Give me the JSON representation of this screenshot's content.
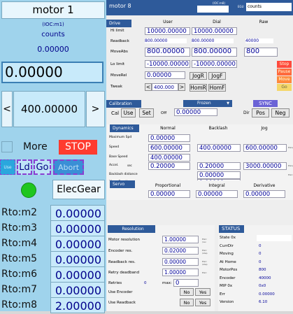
{
  "left": {
    "motor_title": "motor 1",
    "ioc": "(IOC:m1)",
    "units": "counts",
    "readback": "0.00000",
    "position": "0.00000",
    "tweak": "400.00000",
    "tweak_left": "<",
    "tweak_right": ">",
    "more": "More",
    "stop": "STOP",
    "set_label": "Use",
    "load": "Ld",
    "go": "Go",
    "abort": "Abort",
    "elecgear": "ElecGear",
    "ratios": [
      {
        "label": "Rto:m2",
        "value": "0.00000"
      },
      {
        "label": "Rto:m3",
        "value": "0.00000"
      },
      {
        "label": "Rto:m4",
        "value": "0.00000"
      },
      {
        "label": "Rto:m5",
        "value": "0.00000"
      },
      {
        "label": "Rto:m6",
        "value": "0.00000"
      },
      {
        "label": "Rto:m7",
        "value": "0.00000"
      },
      {
        "label": "Rto:m8",
        "value": "2.00000"
      }
    ]
  },
  "right": {
    "title": "motor 8",
    "ioc": "(IOC:m8)",
    "egu_label": "EGU",
    "egu": "counts",
    "drive": {
      "section": "Drive",
      "col_user": "User",
      "col_dial": "Dial",
      "col_raw": "Raw",
      "hilimit_label": "Hi limit",
      "hilimit_user": "10000.00000",
      "hilimit_dial": "10000.00000",
      "readback_label": "Readback",
      "readback_user": "800.00000",
      "readback_dial": "800.00000",
      "readback_raw": "40000",
      "moveabs_label": "MoveAbs",
      "moveabs_user": "800.00000",
      "moveabs_dial": "800.00000",
      "moveabs_raw": "800",
      "lolimit_label": "Lo limit",
      "lolimit_user": "-10000.00000",
      "lolimit_dial": "-10000.00000",
      "moverel_label": "MoveRel",
      "moverel_value": "0.00000",
      "jogr": "JogR",
      "jogf": "JogF",
      "tweak_label": "Tweak",
      "tweak_left": "<",
      "tweak_value": "400.000",
      "tweak_right": ">",
      "homr": "HomR",
      "homf": "HomF",
      "stop": "Stop",
      "pause": "Pause",
      "move": "Move",
      "go": "Go"
    },
    "calibration": {
      "section": "Calibration",
      "frozen": "Frozen",
      "sync": "SYNC",
      "cal": "Cal",
      "use": "Use",
      "set": "Set",
      "off": "Off",
      "off_value": "0.00000",
      "dir": "Dir",
      "pos": "Pos",
      "neg": "Neg"
    },
    "dynamics": {
      "section": "Dynamics",
      "col_normal": "Normal",
      "col_backlash": "Backlash",
      "col_jog": "Jog",
      "rows": [
        {
          "label": "Maximum Spd",
          "normal": "0.00000",
          "backlash": "",
          "jog": "",
          "unit": ""
        },
        {
          "label": "Speed",
          "normal": "600.00000",
          "backlash": "400.00000",
          "jog": "600.00000",
          "unit": "EGU/s"
        },
        {
          "label": "Base Speed",
          "normal": "400.00000",
          "backlash": "",
          "jog": "",
          "unit": ""
        },
        {
          "label": "Accel.",
          "sublabel": "sec",
          "normal": "0.20000",
          "backlash": "0.20000",
          "jog": "3000.00000",
          "unit": "EGU/s²"
        },
        {
          "label": "Backlash distance",
          "normal": "",
          "backlash": "0.00000",
          "jog": "",
          "unit": "EGU"
        },
        {
          "label": "Move Fraction",
          "normal": "",
          "backlash": "1.00000",
          "jog": "",
          "unit": ""
        }
      ]
    },
    "servo": {
      "section": "Servo",
      "col_p": "Proportional",
      "col_i": "Integral",
      "col_d": "Derivative",
      "p": "0.00000",
      "i": "0.00000",
      "d": "0.00000"
    },
    "resolution": {
      "section": "Resolution",
      "motor_res_label": "Motor resolution",
      "motor_res": "1.00000",
      "encoder_res_label": "Encoder res.",
      "encoder_res": "0.02000",
      "readback_res_label": "Readback res.",
      "readback_res": "0.00000",
      "retry_label": "Retry deadband",
      "retry": "1.00000",
      "retries_label": "Retries",
      "retries_value": "0",
      "max_label": "max:",
      "max_value": "0",
      "use_encoder_label": "Use Encoder",
      "use_readback_label": "Use Readback",
      "no": "No",
      "yes": "Yes"
    },
    "status": {
      "section": "STATUS",
      "rows": [
        {
          "label": "State 0x",
          "value": ""
        },
        {
          "label": "CurrDir",
          "value": "0"
        },
        {
          "label": "Moving",
          "value": "0"
        },
        {
          "label": "At Home",
          "value": "0"
        },
        {
          "label": "MotorPos",
          "value": "800"
        },
        {
          "label": "Encoder",
          "value": "40000"
        },
        {
          "label": "MIP 0x",
          "value": "0x0"
        },
        {
          "label": "Err",
          "value": "0.00000"
        },
        {
          "label": "Version",
          "value": "6.10"
        }
      ]
    }
  },
  "colors": {
    "left_bg": "#9fd3ec",
    "stop": "#ff3b2f",
    "section": "#2e5a9a",
    "indicator": "#1fc61f",
    "dashed": "#8a3fd1"
  }
}
